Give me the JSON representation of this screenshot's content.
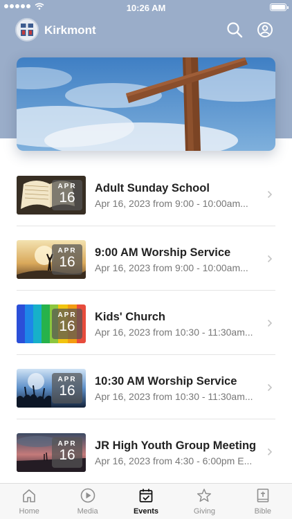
{
  "status_bar": {
    "time": "10:26 AM"
  },
  "app": {
    "name": "Kirkmont"
  },
  "events": [
    {
      "month": "APR",
      "day": "16",
      "title": "Adult Sunday School",
      "subtitle": "Apr 16, 2023 from 9:00 - 10:00am..."
    },
    {
      "month": "APR",
      "day": "16",
      "title": "9:00 AM Worship Service",
      "subtitle": "Apr 16, 2023 from 9:00 - 10:00am..."
    },
    {
      "month": "APR",
      "day": "16",
      "title": "Kids' Church",
      "subtitle": "Apr 16, 2023 from 10:30 - 11:30am..."
    },
    {
      "month": "APR",
      "day": "16",
      "title": "10:30 AM Worship Service",
      "subtitle": "Apr 16, 2023 from 10:30 - 11:30am..."
    },
    {
      "month": "APR",
      "day": "16",
      "title": "JR High Youth Group Meeting",
      "subtitle": "Apr 16, 2023 from 4:30 - 6:00pm E..."
    }
  ],
  "tabs": [
    {
      "label": "Home",
      "icon": "home-icon"
    },
    {
      "label": "Media",
      "icon": "play-icon"
    },
    {
      "label": "Events",
      "icon": "calendar-icon",
      "active": true
    },
    {
      "label": "Giving",
      "icon": "star-icon"
    },
    {
      "label": "Bible",
      "icon": "bible-icon"
    }
  ],
  "colors": {
    "header": "#9aadc9",
    "active_tab": "#111111",
    "inactive_tab": "#8e8e8e"
  }
}
